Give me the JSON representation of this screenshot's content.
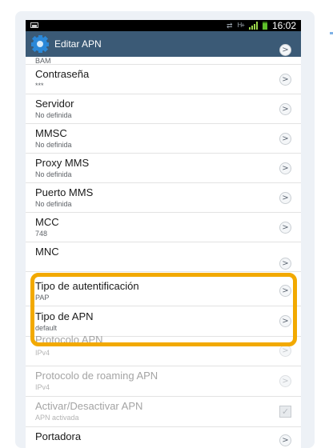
{
  "statusbar": {
    "time": "16:02",
    "ht": "H+"
  },
  "actionbar": {
    "title": "Editar APN"
  },
  "items": [
    {
      "label": "",
      "sub": "BAM",
      "control": "chevron"
    },
    {
      "label": "Contraseña",
      "sub": "***",
      "control": "chevron"
    },
    {
      "label": "Servidor",
      "sub": "No definida",
      "control": "chevron"
    },
    {
      "label": "MMSC",
      "sub": "No definida",
      "control": "chevron"
    },
    {
      "label": "Proxy MMS",
      "sub": "No definida",
      "control": "chevron"
    },
    {
      "label": "Puerto MMS",
      "sub": "No definida",
      "control": "chevron"
    },
    {
      "label": "MCC",
      "sub": "748",
      "control": "chevron"
    },
    {
      "label": "MNC",
      "sub": "",
      "control": "chevron"
    },
    {
      "label": "Tipo de autentificación",
      "sub": "PAP",
      "control": "chevron",
      "highlighted": true
    },
    {
      "label": "Tipo de APN",
      "sub": "default",
      "control": "chevron",
      "highlighted": true
    },
    {
      "label": "Protocolo APN",
      "sub": "IPv4",
      "control": "chevron",
      "disabled": true
    },
    {
      "label": "Protocolo de roaming APN",
      "sub": "IPv4",
      "control": "chevron",
      "disabled": true
    },
    {
      "label": "Activar/Desactivar APN",
      "sub": "APN activada",
      "control": "checkbox",
      "checked": true,
      "disabled": true
    },
    {
      "label": "Portadora",
      "sub": "",
      "control": "chevron"
    }
  ],
  "colors": {
    "actionbar": "#3b5a76",
    "highlight": "#f2a900",
    "background": "#edf1f6"
  }
}
